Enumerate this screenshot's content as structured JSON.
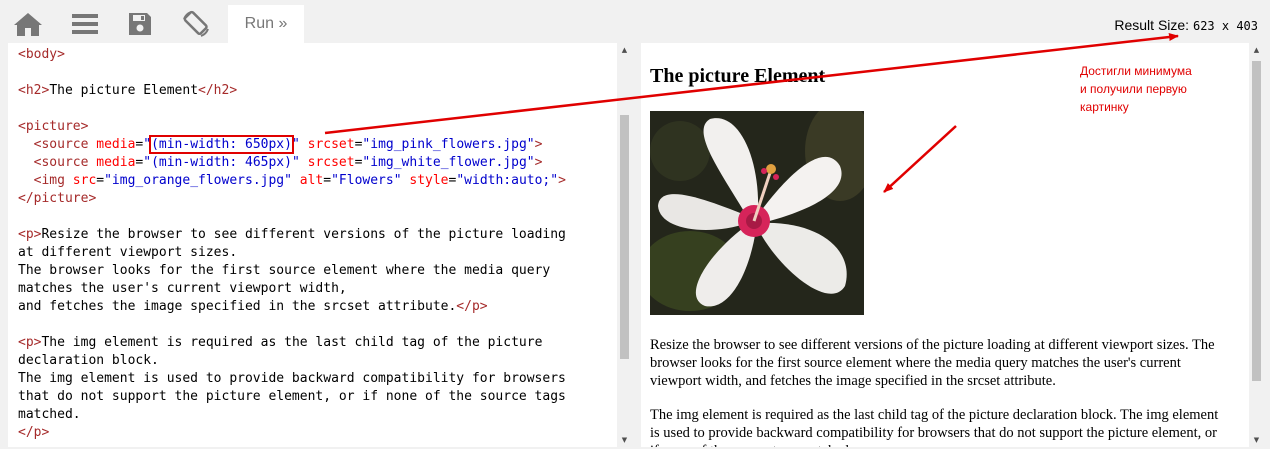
{
  "toolbar": {
    "home_icon": "home-icon",
    "menu_icon": "hamburger-menu-icon",
    "save_icon": "floppy-disk-icon",
    "rotate_icon": "rotate-screen-icon",
    "run_label": "Run »",
    "result_size_label": "Result Size:",
    "result_size_value": "623 x 403"
  },
  "code_lines": [
    "<body>",
    "",
    "<h2>The picture Element</h2>",
    "",
    "<picture>",
    "  <source media=\"(min-width: 650px)\" srcset=\"img_pink_flowers.jpg\">",
    "  <source media=\"(min-width: 465px)\" srcset=\"img_white_flower.jpg\">",
    "  <img src=\"img_orange_flowers.jpg\" alt=\"Flowers\" style=\"width:auto;\">",
    "</picture>",
    "",
    "<p>Resize the browser to see different versions of the picture loading",
    "at different viewport sizes.",
    "The browser looks for the first source element where the media query",
    "matches the user's current viewport width,",
    "and fetches the image specified in the srcset attribute.</p>",
    "",
    "<p>The img element is required as the last child tag of the picture",
    "declaration block.",
    "The img element is used to provide backward compatibility for browsers",
    "that do not support the picture element, or if none of the source tags",
    "matched.",
    "</p>"
  ],
  "result": {
    "heading": "The picture Element",
    "image_alt": "Flowers",
    "para1": "Resize the browser to see different versions of the picture loading at different viewport sizes. The browser looks for the first source element where the media query matches the user's current viewport width, and fetches the image specified in the srcset attribute.",
    "para2": "The img element is required as the last child tag of the picture declaration block. The img element is used to provide backward compatibility for browsers that do not support the picture element, or if none of the source tags matched."
  },
  "annotation": {
    "text": "Достигли минимума\nи получили первую\nкартинку",
    "color": "#e00000"
  },
  "colors": {
    "tag": "#a52a2a",
    "attribute": "#ff0000",
    "value": "#0000cd",
    "toolbar_bg": "#f1f1f1",
    "icon": "#777777"
  }
}
